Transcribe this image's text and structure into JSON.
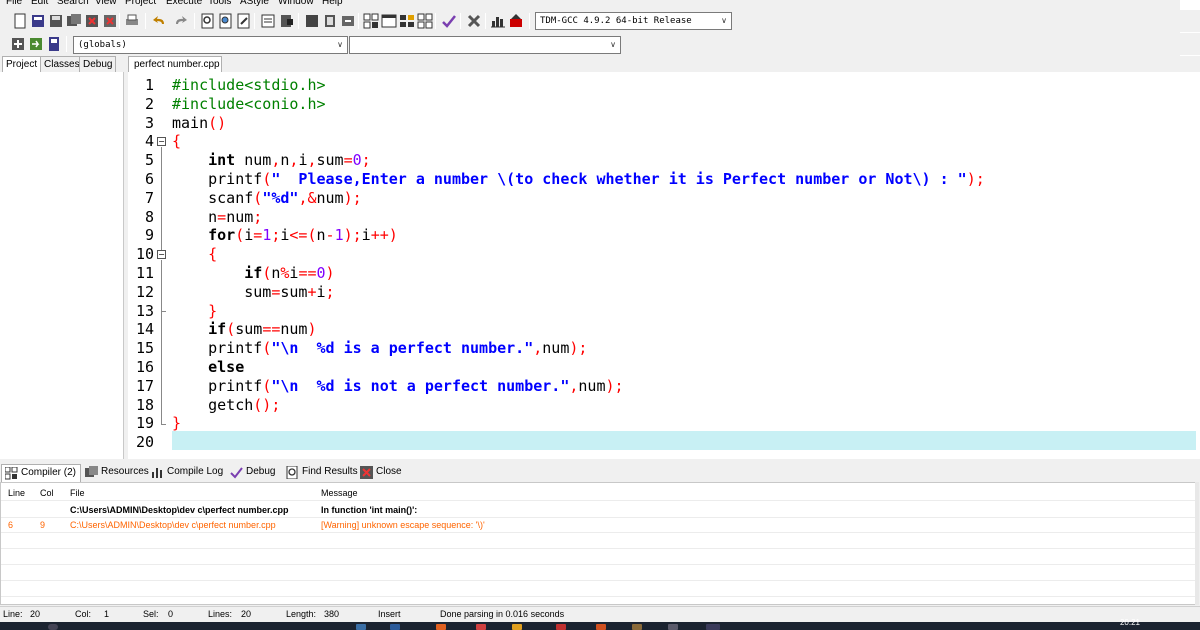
{
  "menu": [
    "File",
    "Edit",
    "Search",
    "View",
    "Project",
    "Execute",
    "Tools",
    "AStyle",
    "Window",
    "Help"
  ],
  "toolbar": {
    "compiler_select": "TDM-GCC 4.9.2 64-bit Release",
    "scope_select": "(globals)",
    "member_select": ""
  },
  "left_tabs": [
    "Project",
    "Classes",
    "Debug"
  ],
  "editor_tab": "perfect number.cpp",
  "code": {
    "line_numbers": [
      "1",
      "2",
      "3",
      "4",
      "5",
      "6",
      "7",
      "8",
      "9",
      "10",
      "11",
      "12",
      "13",
      "14",
      "15",
      "16",
      "17",
      "18",
      "19",
      "20"
    ],
    "current_line": 20
  },
  "bottom_tabs": [
    {
      "label": "Compiler (2)",
      "icon": "grid-icon"
    },
    {
      "label": "Resources",
      "icon": "resources-icon"
    },
    {
      "label": "Compile Log",
      "icon": "chart-icon"
    },
    {
      "label": "Debug",
      "icon": "check-icon"
    },
    {
      "label": "Find Results",
      "icon": "find-icon"
    },
    {
      "label": "Close",
      "icon": "close-icon"
    }
  ],
  "messages": {
    "headers": [
      "Line",
      "Col",
      "File",
      "Message"
    ],
    "rows": [
      {
        "line": "",
        "col": "",
        "file": "C:\\Users\\ADMIN\\Desktop\\dev c\\perfect number.cpp",
        "message": "In function 'int main()':",
        "type": "info"
      },
      {
        "line": "6",
        "col": "9",
        "file": "C:\\Users\\ADMIN\\Desktop\\dev c\\perfect number.cpp",
        "message": "[Warning] unknown escape sequence: '\\)'",
        "type": "warning"
      }
    ]
  },
  "status": {
    "line_label": "Line:",
    "line": "20",
    "col_label": "Col:",
    "col": "1",
    "sel_label": "Sel:",
    "sel": "0",
    "lines_label": "Lines:",
    "lines": "20",
    "length_label": "Length:",
    "length": "380",
    "mode": "Insert",
    "message": "Done parsing in 0.016 seconds"
  },
  "taskbar": {
    "clock": "20:21"
  },
  "colors": {
    "keyword": "#000000",
    "preprocessor": "#008000",
    "string": "#0000ff",
    "number": "#8000ff",
    "operator": "#ff0000",
    "current_line": "#c8f0f4",
    "warning": "#ff6400"
  }
}
